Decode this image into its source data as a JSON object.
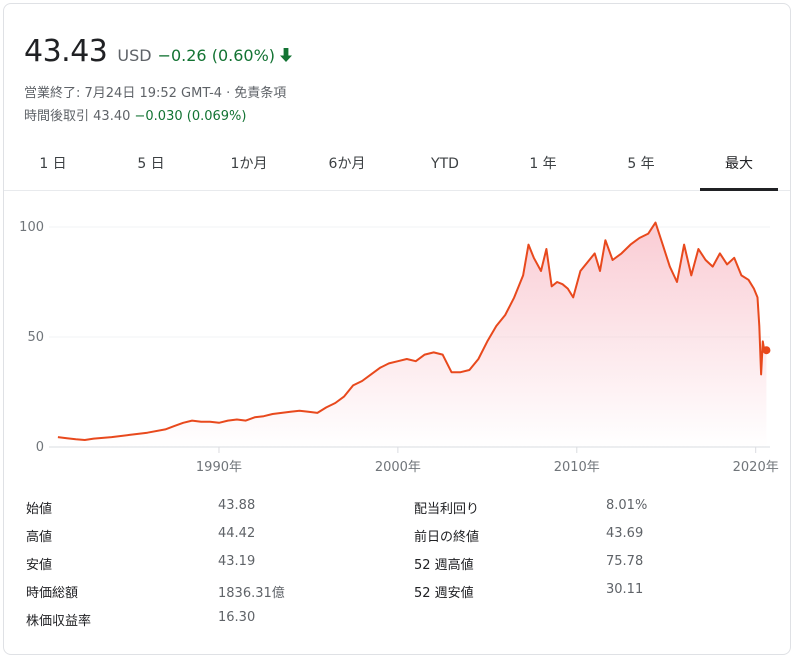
{
  "quote": {
    "price": "43.43",
    "currency": "USD",
    "change": "−0.26 (0.60%)",
    "direction": "down",
    "status_line": "営業終了: 7月24日 19:52 GMT-4",
    "disclaimer": "免責条項",
    "after_hours_label": "時間後取引",
    "after_hours_price": "43.40",
    "after_hours_change": "−0.030 (0.069%)"
  },
  "tabs": [
    {
      "label": "1 日",
      "active": false
    },
    {
      "label": "5 日",
      "active": false
    },
    {
      "label": "1か月",
      "active": false
    },
    {
      "label": "6か月",
      "active": false
    },
    {
      "label": "YTD",
      "active": false
    },
    {
      "label": "1 年",
      "active": false
    },
    {
      "label": "5 年",
      "active": false
    },
    {
      "label": "最大",
      "active": true
    }
  ],
  "colors": {
    "line": "#e8491d",
    "fill": "#f9c6cf",
    "positive": "#137333",
    "grid": "#f1f3f4"
  },
  "chart_data": {
    "type": "area",
    "x_tick_labels": [
      "1990年",
      "2000年",
      "2010年",
      "2020年"
    ],
    "x_ticks": [
      1990,
      2000,
      2010,
      2020
    ],
    "y_ticks": [
      0,
      50,
      100
    ],
    "xlim": [
      1980.5,
      2020.8
    ],
    "ylim": [
      0,
      105
    ],
    "grid": "horizontal",
    "x": [
      1981.0,
      1981.5,
      1982.0,
      1982.5,
      1983.0,
      1984.0,
      1985.0,
      1986.0,
      1987.0,
      1987.5,
      1988.0,
      1988.5,
      1989.0,
      1989.5,
      1990.0,
      1990.5,
      1991.0,
      1991.5,
      1992.0,
      1992.5,
      1993.0,
      1993.5,
      1994.0,
      1994.5,
      1995.0,
      1995.5,
      1996.0,
      1996.5,
      1997.0,
      1997.5,
      1998.0,
      1998.5,
      1999.0,
      1999.5,
      2000.0,
      2000.5,
      2001.0,
      2001.5,
      2002.0,
      2002.5,
      2003.0,
      2003.5,
      2004.0,
      2004.5,
      2005.0,
      2005.5,
      2006.0,
      2006.5,
      2007.0,
      2007.3,
      2007.6,
      2008.0,
      2008.3,
      2008.6,
      2008.9,
      2009.2,
      2009.5,
      2009.8,
      2010.2,
      2010.6,
      2011.0,
      2011.3,
      2011.6,
      2012.0,
      2012.5,
      2013.0,
      2013.5,
      2014.0,
      2014.4,
      2014.8,
      2015.2,
      2015.6,
      2016.0,
      2016.4,
      2016.8,
      2017.2,
      2017.6,
      2018.0,
      2018.4,
      2018.8,
      2019.2,
      2019.6,
      2019.9,
      2020.1,
      2020.2,
      2020.3,
      2020.4,
      2020.5,
      2020.6
    ],
    "y": [
      4.5,
      4.0,
      3.5,
      3.2,
      3.8,
      4.5,
      5.5,
      6.5,
      8.0,
      9.5,
      11.0,
      12.0,
      11.5,
      11.5,
      11.0,
      12.0,
      12.5,
      12.0,
      13.5,
      14.0,
      15.0,
      15.5,
      16.0,
      16.5,
      16.0,
      15.5,
      18.0,
      20.0,
      23.0,
      28.0,
      30.0,
      33.0,
      36.0,
      38.0,
      39.0,
      40.0,
      39.0,
      42.0,
      43.0,
      42.0,
      34.0,
      34.0,
      35.0,
      40.0,
      48.0,
      55.0,
      60.0,
      68.0,
      78.0,
      92.0,
      86.0,
      80.0,
      90.0,
      73.0,
      75.0,
      74.0,
      72.0,
      68.0,
      80.0,
      84.0,
      88.0,
      80.0,
      94.0,
      85.0,
      88.0,
      92.0,
      95.0,
      97.0,
      102.0,
      92.0,
      82.0,
      75.0,
      92.0,
      78.0,
      90.0,
      85.0,
      82.0,
      88.0,
      83.0,
      86.0,
      78.0,
      76.0,
      72.0,
      68.0,
      55.0,
      33.0,
      48.0,
      43.0,
      44.0
    ]
  },
  "stats": {
    "left": [
      {
        "label": "始値",
        "value": "43.88"
      },
      {
        "label": "高値",
        "value": "44.42"
      },
      {
        "label": "安値",
        "value": "43.19"
      },
      {
        "label": "時価総額",
        "value": "1836.31億"
      },
      {
        "label": "株価収益率",
        "value": "16.30"
      }
    ],
    "right": [
      {
        "label": "配当利回り",
        "value": "8.01%"
      },
      {
        "label": "前日の終値",
        "value": "43.69"
      },
      {
        "label": "52 週高値",
        "value": "75.78"
      },
      {
        "label": "52 週安値",
        "value": "30.11"
      }
    ]
  }
}
